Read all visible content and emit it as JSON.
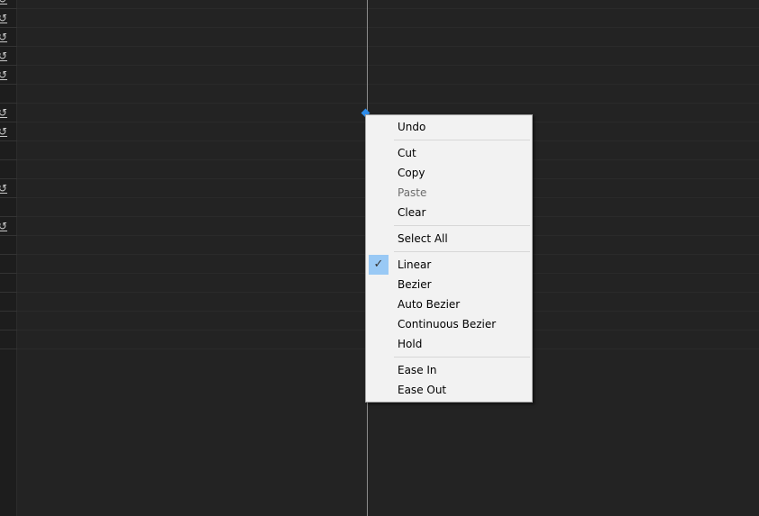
{
  "panel": {
    "reset_icon": "reset-undo-arrow-icon",
    "reset_rows": [
      0,
      1,
      2,
      3,
      5,
      6,
      9,
      11
    ]
  },
  "menu": {
    "items": [
      {
        "label": "Undo"
      },
      {
        "sep": true
      },
      {
        "label": "Cut"
      },
      {
        "label": "Copy"
      },
      {
        "label": "Paste",
        "disabled": true
      },
      {
        "label": "Clear"
      },
      {
        "sep": true
      },
      {
        "label": "Select All"
      },
      {
        "sep": true
      },
      {
        "label": "Linear",
        "checked": true
      },
      {
        "label": "Bezier"
      },
      {
        "label": "Auto Bezier"
      },
      {
        "label": "Continuous Bezier"
      },
      {
        "label": "Hold"
      },
      {
        "sep": true
      },
      {
        "label": "Ease In"
      },
      {
        "label": "Ease Out"
      }
    ]
  },
  "colors": {
    "keyframe": "#2d8ceb",
    "check_highlight": "#99c9f5",
    "menu_bg": "#f2f2f2"
  }
}
